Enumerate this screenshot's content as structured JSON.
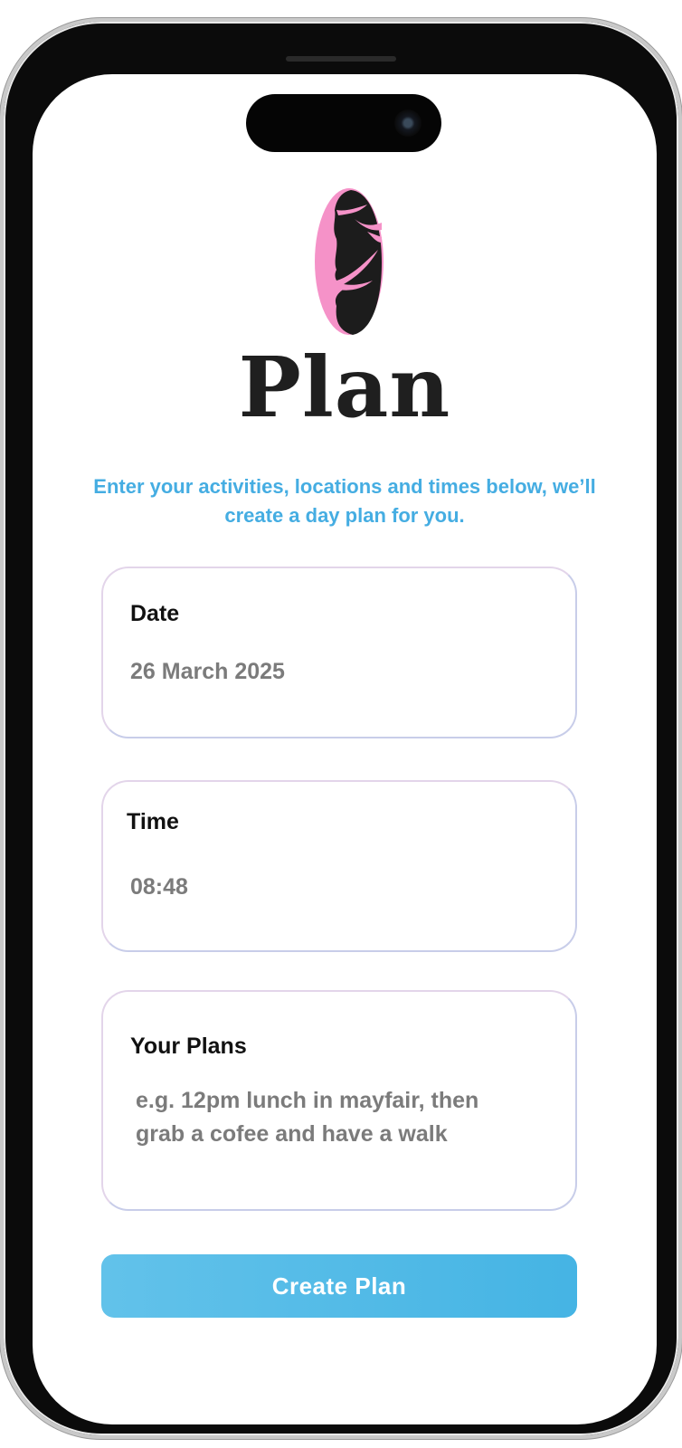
{
  "app": {
    "title": "Plan",
    "subtitle": "Enter your activities, locations and times below, we’ll create a day plan for you."
  },
  "form": {
    "date": {
      "label": "Date",
      "value": "26 March 2025"
    },
    "time": {
      "label": "Time",
      "value": "08:48"
    },
    "plans": {
      "label": "Your Plans",
      "placeholder": "e.g. 12pm lunch in mayfair, then grab a cofee and have a walk"
    }
  },
  "actions": {
    "create_label": "Create Plan"
  },
  "colors": {
    "accent": "#45ADE2",
    "logo_pink": "#F592C8",
    "title_text": "#1F1F1F",
    "placeholder_text": "#7B7B7B"
  },
  "icons": {
    "logo": "app-logo-oval-pink-black"
  }
}
